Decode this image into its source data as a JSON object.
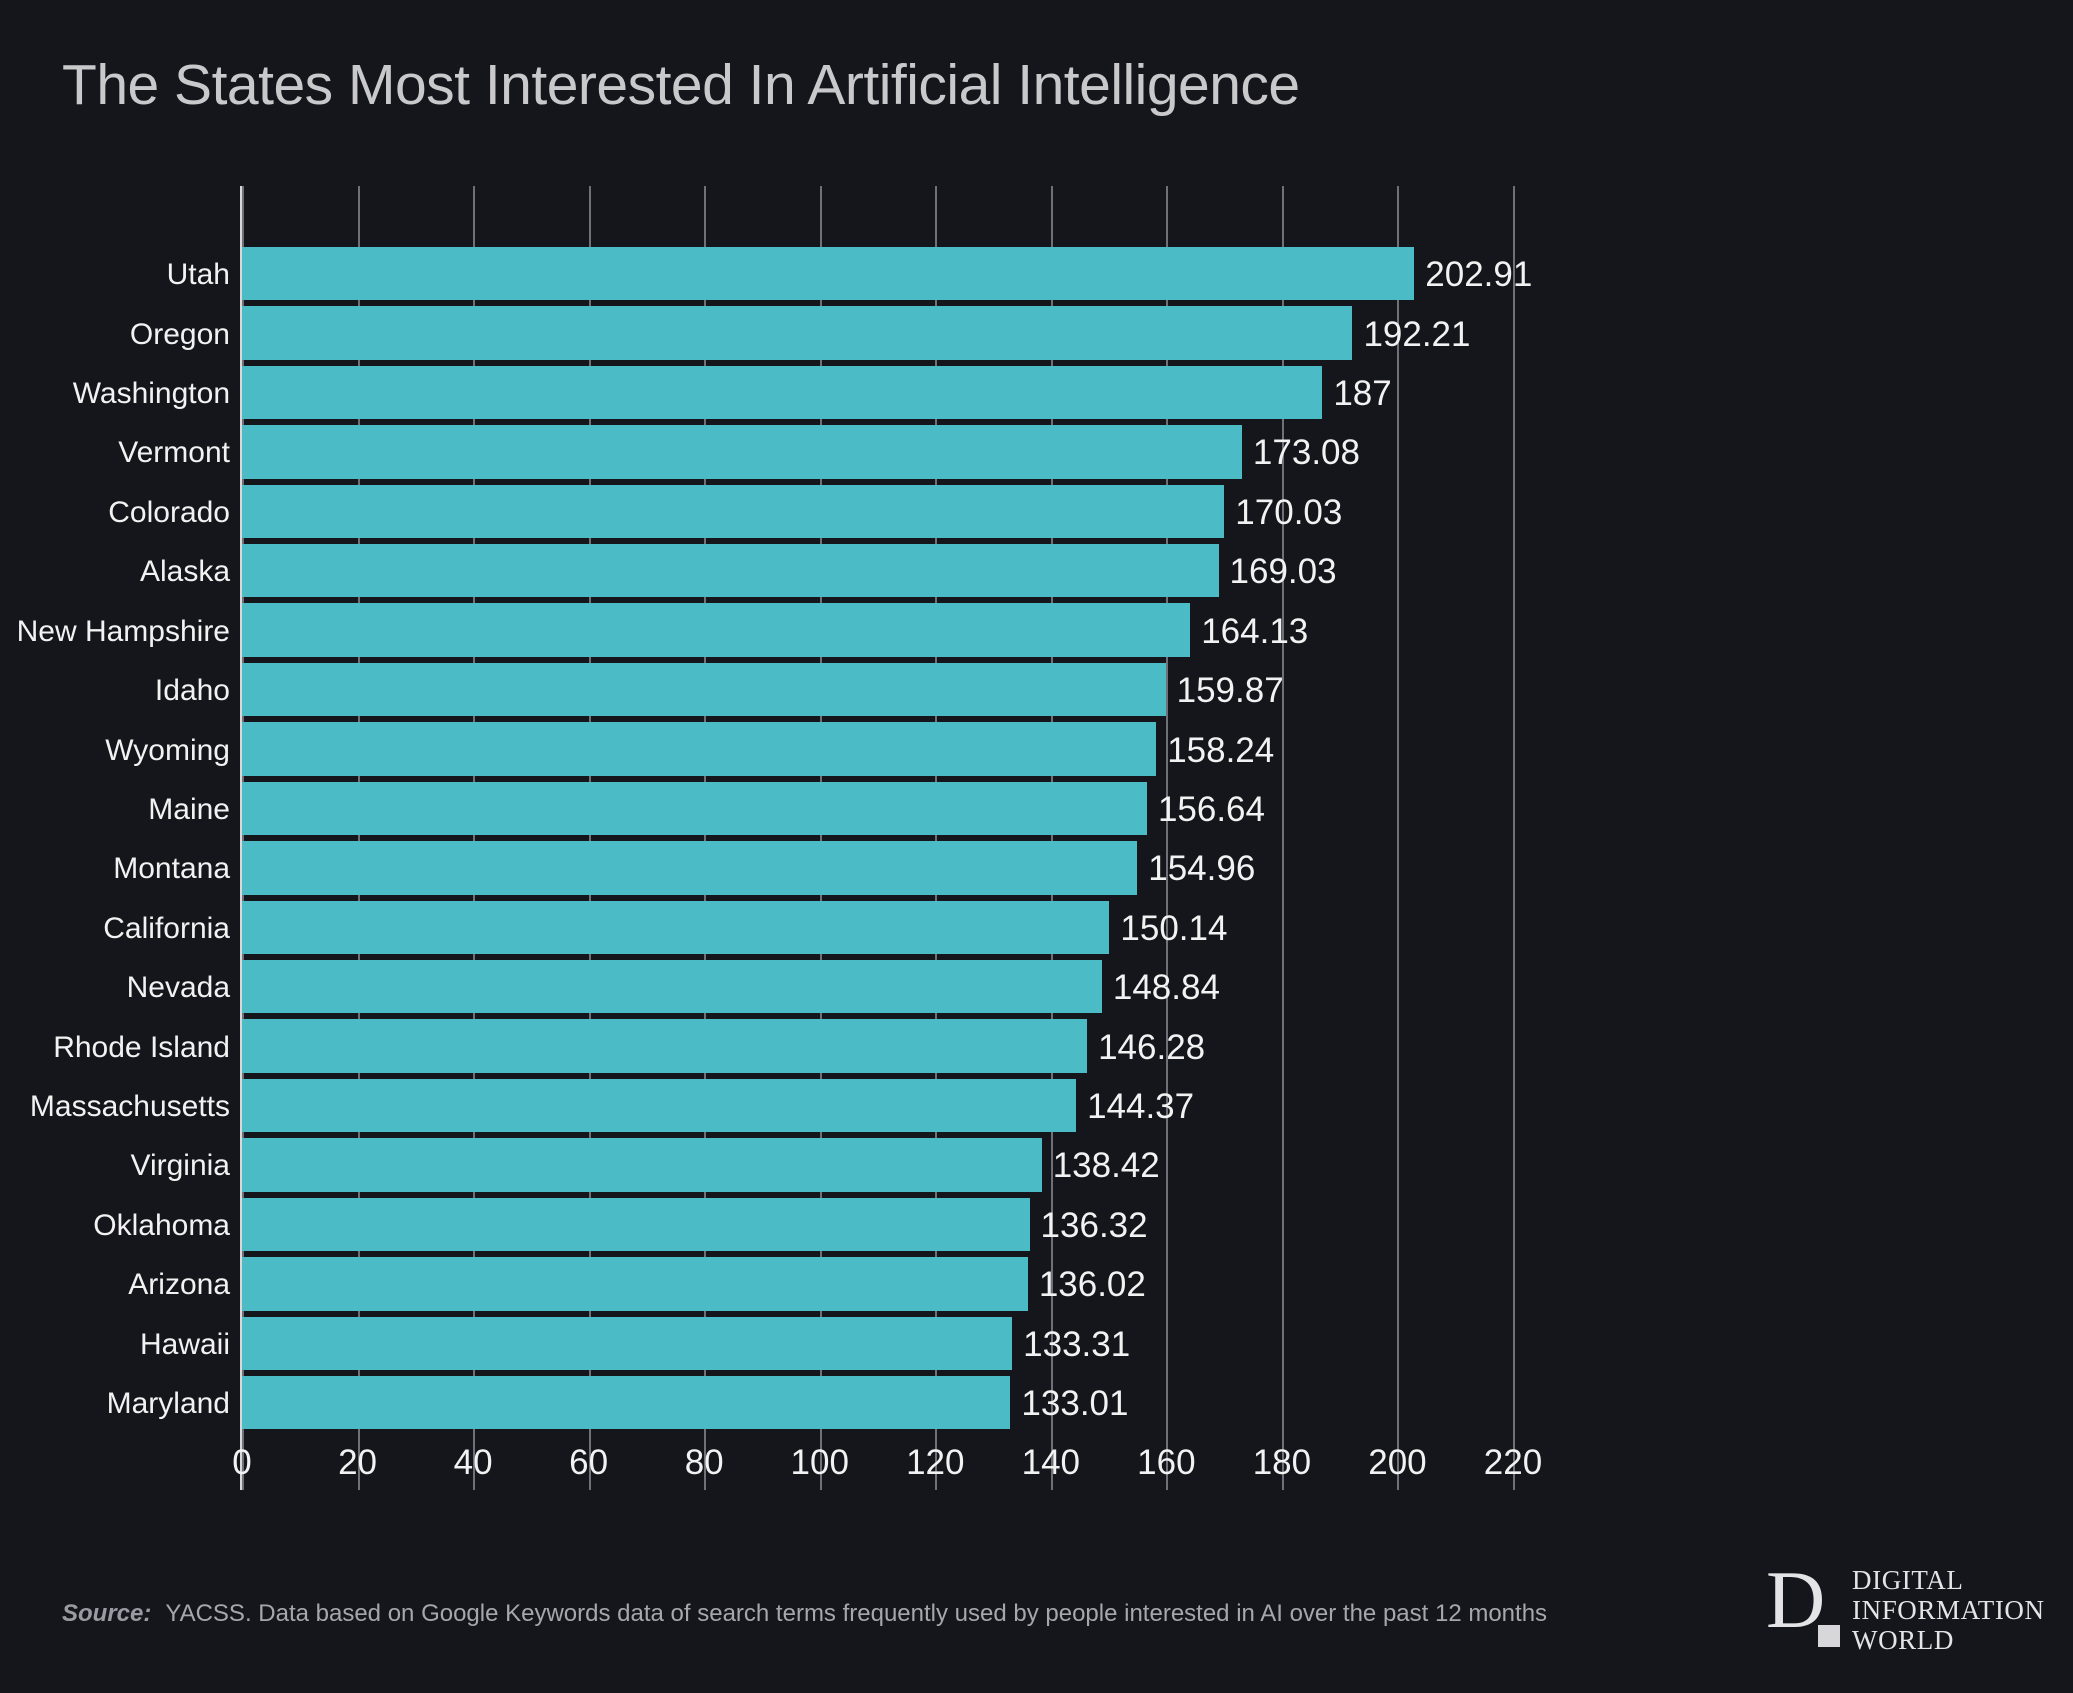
{
  "title": "The States Most Interested In Artificial Intelligence",
  "colors": {
    "background": "#15161c",
    "bar": "#4bbcc6",
    "title_text": "#c9c9cc",
    "label_text": "#f2f2f2",
    "gridline": "#6f7078",
    "source_text": "#a6a6ad"
  },
  "source": {
    "label": "Source:",
    "text": "YACSS. Data based on Google Keywords data of search terms frequently used by people interested in AI over the past 12 months"
  },
  "logo": {
    "mark": "D",
    "line1": "DIGITAL",
    "line2": "INFORMATION",
    "line3": "WORLD"
  },
  "chart_data": {
    "type": "bar",
    "orientation": "horizontal",
    "title": "The States Most Interested In Artificial Intelligence",
    "xlabel": "",
    "ylabel": "",
    "xlim": [
      0,
      220
    ],
    "xticks": [
      0,
      20,
      40,
      60,
      80,
      100,
      120,
      140,
      160,
      180,
      200,
      220
    ],
    "grid": "vertical",
    "legend": null,
    "categories": [
      "Utah",
      "Oregon",
      "Washington",
      "Vermont",
      "Colorado",
      "Alaska",
      "New Hampshire",
      "Idaho",
      "Wyoming",
      "Maine",
      "Montana",
      "California",
      "Nevada",
      "Rhode Island",
      "Massachusetts",
      "Virginia",
      "Oklahoma",
      "Arizona",
      "Hawaii",
      "Maryland"
    ],
    "values": [
      202.91,
      192.21,
      187,
      173.08,
      170.03,
      169.03,
      164.13,
      159.87,
      158.24,
      156.64,
      154.96,
      150.14,
      148.84,
      146.28,
      144.37,
      138.42,
      136.32,
      136.02,
      133.31,
      133.01
    ],
    "value_labels": [
      "202.91",
      "192.21",
      "187",
      "173.08",
      "170.03",
      "169.03",
      "164.13",
      "159.87",
      "158.24",
      "156.64",
      "154.96",
      "150.14",
      "148.84",
      "146.28",
      "144.37",
      "138.42",
      "136.32",
      "136.02",
      "133.31",
      "133.01"
    ]
  }
}
